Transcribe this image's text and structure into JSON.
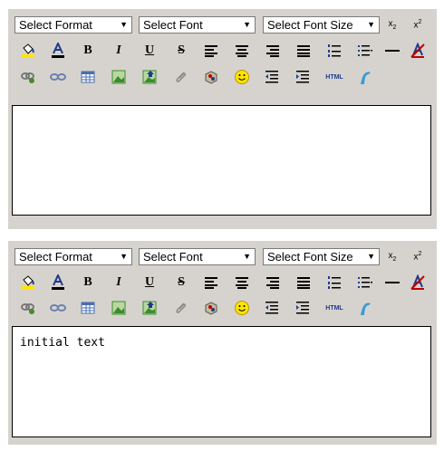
{
  "editors": [
    {
      "select_format": "Select Format",
      "select_font": "Select Font",
      "select_font_size": "Select Font Size",
      "content_text": ""
    },
    {
      "select_format": "Select Format",
      "select_font": "Select Font",
      "select_font_size": "Select Font Size",
      "content_text": "initial text"
    }
  ],
  "toolbar": {
    "subscript_icon": "subscript-icon",
    "superscript_icon": "superscript-icon",
    "bold_label": "B",
    "italic_label": "I",
    "underline_label": "U",
    "strike_label": "S",
    "html_label": "HTML",
    "dropdown_arrow": "▼",
    "subscript_label": "x",
    "subscript_small": "2",
    "superscript_label": "x",
    "superscript_small": "2"
  },
  "colors": {
    "toolbar_bg": "#d6d3ce",
    "border": "#000000",
    "icon_blue": "#1f3a8a",
    "icon_red": "#c00000",
    "fill_yellow": "#ffe400",
    "image_green": "#3c8c2e",
    "link_green": "#4a8a2c"
  }
}
